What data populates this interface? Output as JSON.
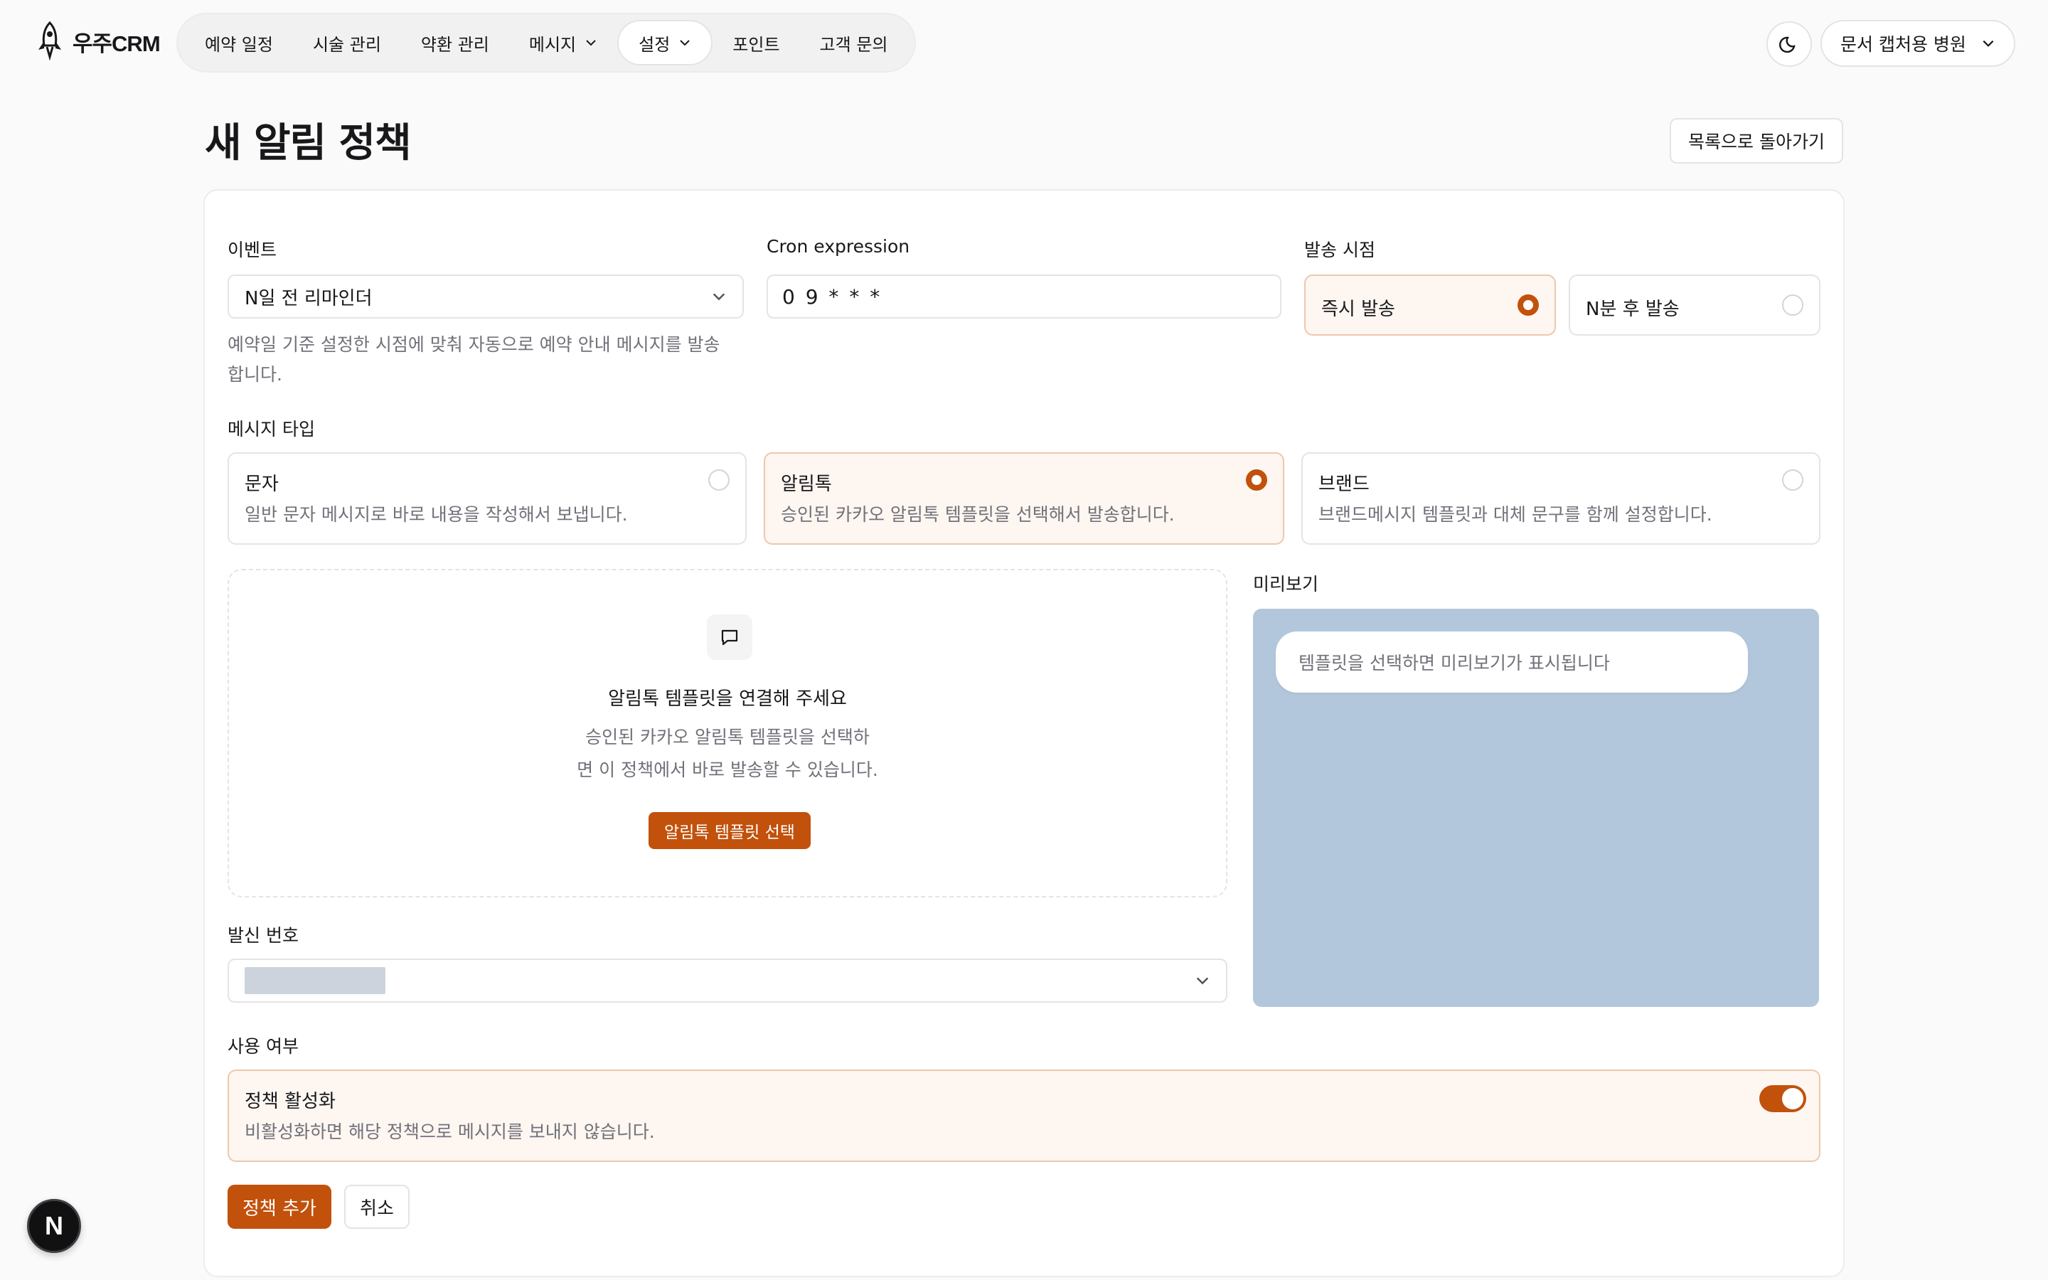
{
  "brand": {
    "name": "우주CRM",
    "icon": "rocket-icon"
  },
  "nav": {
    "items": [
      {
        "label": "예약 일정"
      },
      {
        "label": "시술 관리"
      },
      {
        "label": "약환 관리"
      },
      {
        "label": "메시지"
      },
      {
        "label": "설정"
      },
      {
        "label": "포인트"
      },
      {
        "label": "고객 문의"
      }
    ],
    "active": "설정"
  },
  "header": {
    "theme_icon": "moon-icon",
    "clinic": "문서 캡처용 병원"
  },
  "page": {
    "title": "새 알림 정책",
    "back_label": "목록으로 돌아가기"
  },
  "form": {
    "event": {
      "label": "이벤트",
      "value": "N일 전 리마인더",
      "helper": [
        "예약일 기준 설정한 시점에 맞춰 자동으로 예약 안내 메시지를 발송",
        "합니다."
      ]
    },
    "cron": {
      "label": "Cron expression",
      "value": "0 9 * * *"
    },
    "send_timing": {
      "label": "발송 시점",
      "options": [
        {
          "label": "즉시 발송",
          "selected": true
        },
        {
          "label": "N분 후 발송",
          "selected": false
        }
      ]
    },
    "message_type": {
      "label": "메시지 타입",
      "options": [
        {
          "title": "문자",
          "desc": "일반 문자 메시지로 바로 내용을 작성해서 보냅니다.",
          "selected": false
        },
        {
          "title": "알림톡",
          "desc": "승인된 카카오 알림톡 템플릿을 선택해서 발송합니다.",
          "selected": true
        },
        {
          "title": "브랜드",
          "desc": "브랜드메시지 템플릿과 대체 문구를 함께 설정합니다.",
          "selected": false
        }
      ]
    },
    "template": {
      "icon": "chat-bubble-icon",
      "title": "알림톡 템플릿을 연결해 주세요",
      "desc": [
        "승인된 카카오 알림톡 템플릿을 선택하",
        "면 이 정책에서 바로 발송할 수 있습니다."
      ],
      "button": "알림톡 템플릿 선택"
    },
    "preview": {
      "label": "미리보기",
      "placeholder": "템플릿을 선택하면 미리보기가 표시됩니다"
    },
    "sender": {
      "label": "발신 번호"
    },
    "usage": {
      "label": "사용 여부",
      "toggle_title": "정책 활성화",
      "toggle_desc": "비활성화하면 해당 정책으로 메시지를 보내지 않습니다.",
      "enabled": true
    },
    "submit_label": "정책 추가",
    "cancel_label": "취소"
  },
  "dev_badge": "N",
  "colors": {
    "accent": "#c2510c",
    "accent_soft": "#fdf6f1",
    "preview_bg": "#b3c7dc"
  }
}
